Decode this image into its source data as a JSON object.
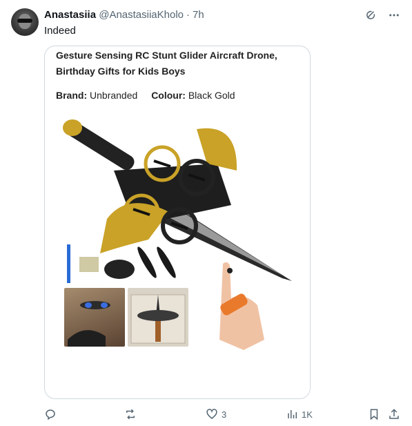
{
  "tweet": {
    "author_name": "Anastasiia",
    "author_handle": "@AnastasiiaKholo",
    "separator": "·",
    "time": "7h",
    "text": "Indeed"
  },
  "media": {
    "product_title": "Gesture Sensing RC Stunt Glider Aircraft Drone, Birthday Gifts for Kids Boys",
    "brand_label": "Brand:",
    "brand_value": "Unbranded",
    "colour_label": "Colour:",
    "colour_value": "Black Gold"
  },
  "actions": {
    "reply_count": "",
    "retweet_count": "",
    "like_count": "3",
    "views_count": "1K"
  },
  "icons": [
    "grok-icon",
    "more-icon",
    "reply-icon",
    "retweet-icon",
    "like-icon",
    "views-icon",
    "bookmark-icon",
    "share-icon"
  ],
  "colors": {
    "text": "#0f1419",
    "muted": "#536471",
    "border": "#cfd9de",
    "gold": "#c9a227"
  }
}
